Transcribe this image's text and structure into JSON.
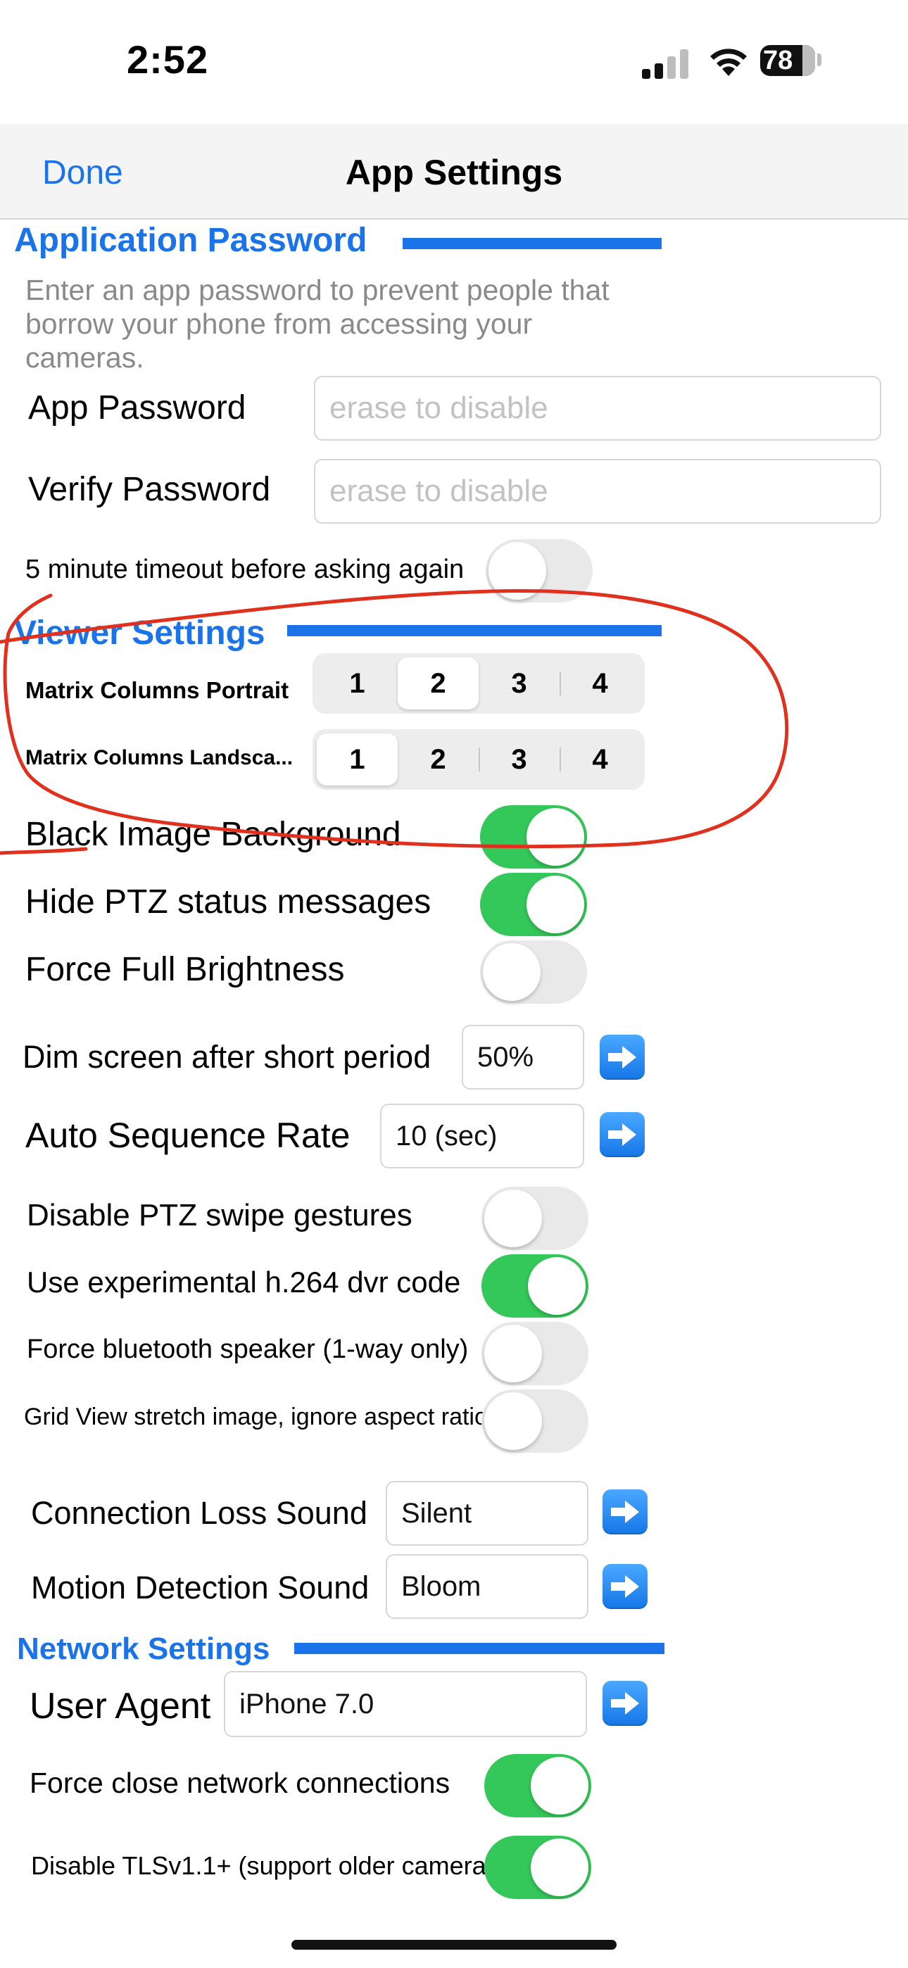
{
  "status_bar": {
    "time": "2:52",
    "battery": "78"
  },
  "nav": {
    "done_label": "Done",
    "title": "App Settings"
  },
  "app_password_section": {
    "title": "Application Password",
    "description": "Enter an app password to prevent people that borrow your phone from accessing your cameras.",
    "app_password": {
      "label": "App Password",
      "placeholder": "erase to disable"
    },
    "verify_password": {
      "label": "Verify Password",
      "placeholder": "erase to disable"
    },
    "timeout": {
      "label": "5 minute timeout before asking again",
      "on": false
    }
  },
  "viewer_section": {
    "title": "Viewer Settings",
    "matrix_portrait": {
      "label": "Matrix Columns Portrait",
      "options": [
        "1",
        "2",
        "3",
        "4"
      ],
      "selected": "2"
    },
    "matrix_landscape": {
      "label": "Matrix Columns Landsca...",
      "options": [
        "1",
        "2",
        "3",
        "4"
      ],
      "selected": "1"
    },
    "black_background": {
      "label": "Black Image Background",
      "on": true
    },
    "hide_ptz": {
      "label": "Hide PTZ status messages",
      "on": true
    },
    "force_brightness": {
      "label": "Force Full Brightness",
      "on": false
    },
    "dim_screen": {
      "label": "Dim screen after short period",
      "value": "50%"
    },
    "auto_sequence": {
      "label": "Auto Sequence Rate",
      "value": "10 (sec)"
    },
    "disable_ptz_swipe": {
      "label": "Disable PTZ swipe gestures",
      "on": false
    },
    "experimental_h264": {
      "label": "Use experimental h.264 dvr code",
      "on": true
    },
    "bluetooth_speaker": {
      "label": "Force bluetooth speaker (1-way only)",
      "on": false
    },
    "grid_stretch": {
      "label": "Grid View stretch image, ignore aspect ratio",
      "on": false
    },
    "connection_loss_sound": {
      "label": "Connection Loss Sound",
      "value": "Silent"
    },
    "motion_detection_sound": {
      "label": "Motion Detection Sound",
      "value": "Bloom"
    }
  },
  "network_section": {
    "title": "Network Settings",
    "user_agent": {
      "label": "User Agent",
      "value": "iPhone 7.0"
    },
    "force_close": {
      "label": "Force close network connections",
      "on": true
    },
    "disable_tls": {
      "label": "Disable TLSv1.1+ (support older camera",
      "on": true
    }
  },
  "colors": {
    "accent": "#1a73e8",
    "toggle_on": "#34c759",
    "annotation": "#e0301e"
  },
  "icons": [
    "signal-icon",
    "wifi-icon",
    "battery-icon",
    "arrow-right-icon"
  ]
}
